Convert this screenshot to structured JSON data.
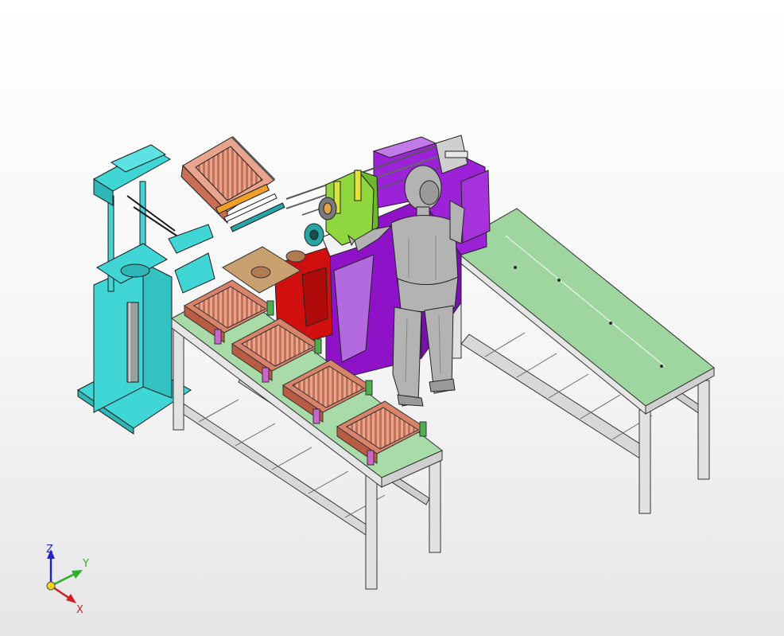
{
  "viewport": {
    "background_top": "#ffffff",
    "background_bottom": "#e6e6e6"
  },
  "triad": {
    "z_label": "Z",
    "y_label": "Y",
    "x_label": "X",
    "z_color": "#2323c8",
    "y_color": "#29b129",
    "x_color": "#d11f1f",
    "origin_color": "#f2d21b"
  },
  "model": {
    "frame_color": "#d9d9d9",
    "tabletop_color": "#a8dba8",
    "press_color": "#41d6d6",
    "machine_base_color": "#8f12c9",
    "green_housing_color": "#8fd63f",
    "tray_color": "#d9836a",
    "red_panel_color": "#d10f0f",
    "operator_color": "#b3b3b3",
    "tray_count": 5
  }
}
